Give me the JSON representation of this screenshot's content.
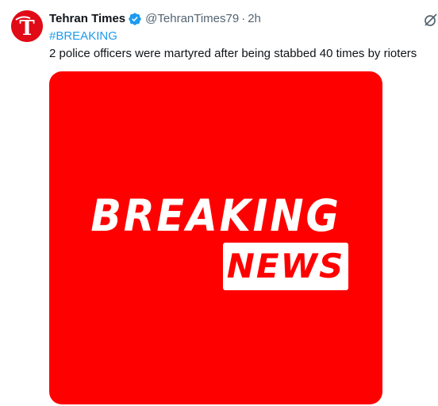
{
  "tweet": {
    "author": {
      "display_name": "Tehran Times",
      "avatar_letter": "T",
      "verified": true,
      "handle": "@TehranTimes79",
      "separator": "·",
      "time": "2h"
    },
    "hashtag": "#BREAKING",
    "text": "2 police officers were martyred after being stabbed 40 times by rioters",
    "media": {
      "headline": "BREAKING",
      "subheadline": "NEWS",
      "background_color": "#ff0000"
    }
  },
  "colors": {
    "link": "#1d9bf0",
    "secondary_text": "#536471",
    "primary_text": "#0f1419",
    "verified_badge": "#1d9bf0"
  },
  "icons": {
    "verified": "verified-badge-icon",
    "grok": "grok-icon"
  }
}
